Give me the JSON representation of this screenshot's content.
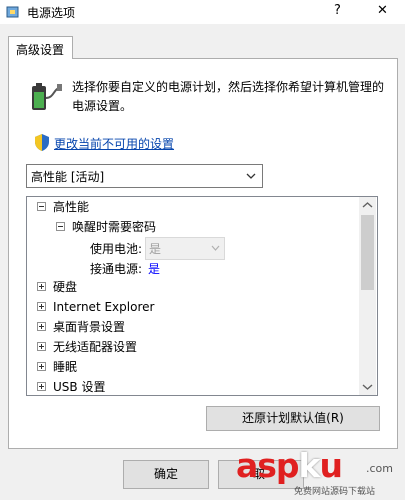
{
  "window": {
    "title": "电源选项",
    "help_glyph": "?",
    "close_glyph": "✕"
  },
  "tab": {
    "label": "高级设置"
  },
  "intro_text": "选择你要自定义的电源计划，然后选择你希望计算机管理的电源设置。",
  "change_link": "更改当前不可用的设置",
  "plan_select": {
    "value": "高性能 [活动]"
  },
  "tree": {
    "root": "高性能",
    "child": "唤醒时需要密码",
    "on_battery_label": "使用电池:",
    "on_battery_value": "是",
    "plugged_in_label": "接通电源:",
    "plugged_in_value": "是",
    "items": [
      {
        "label": "硬盘"
      },
      {
        "label": "Internet Explorer"
      },
      {
        "label": "桌面背景设置"
      },
      {
        "label": "无线适配器设置"
      },
      {
        "label": "睡眠"
      },
      {
        "label": "USB 设置"
      }
    ]
  },
  "buttons": {
    "restore": "还原计划默认值(R)",
    "ok": "确定",
    "cancel": "取"
  },
  "watermark": {
    "main_a": "asp",
    "main_k": "k",
    "main_u": "u",
    "tld": ".com",
    "sub": "免费网站源码下载站"
  },
  "colors": {
    "link": "#0645ad",
    "value_blue": "#0000ff",
    "watermark_red": "#e02020"
  }
}
